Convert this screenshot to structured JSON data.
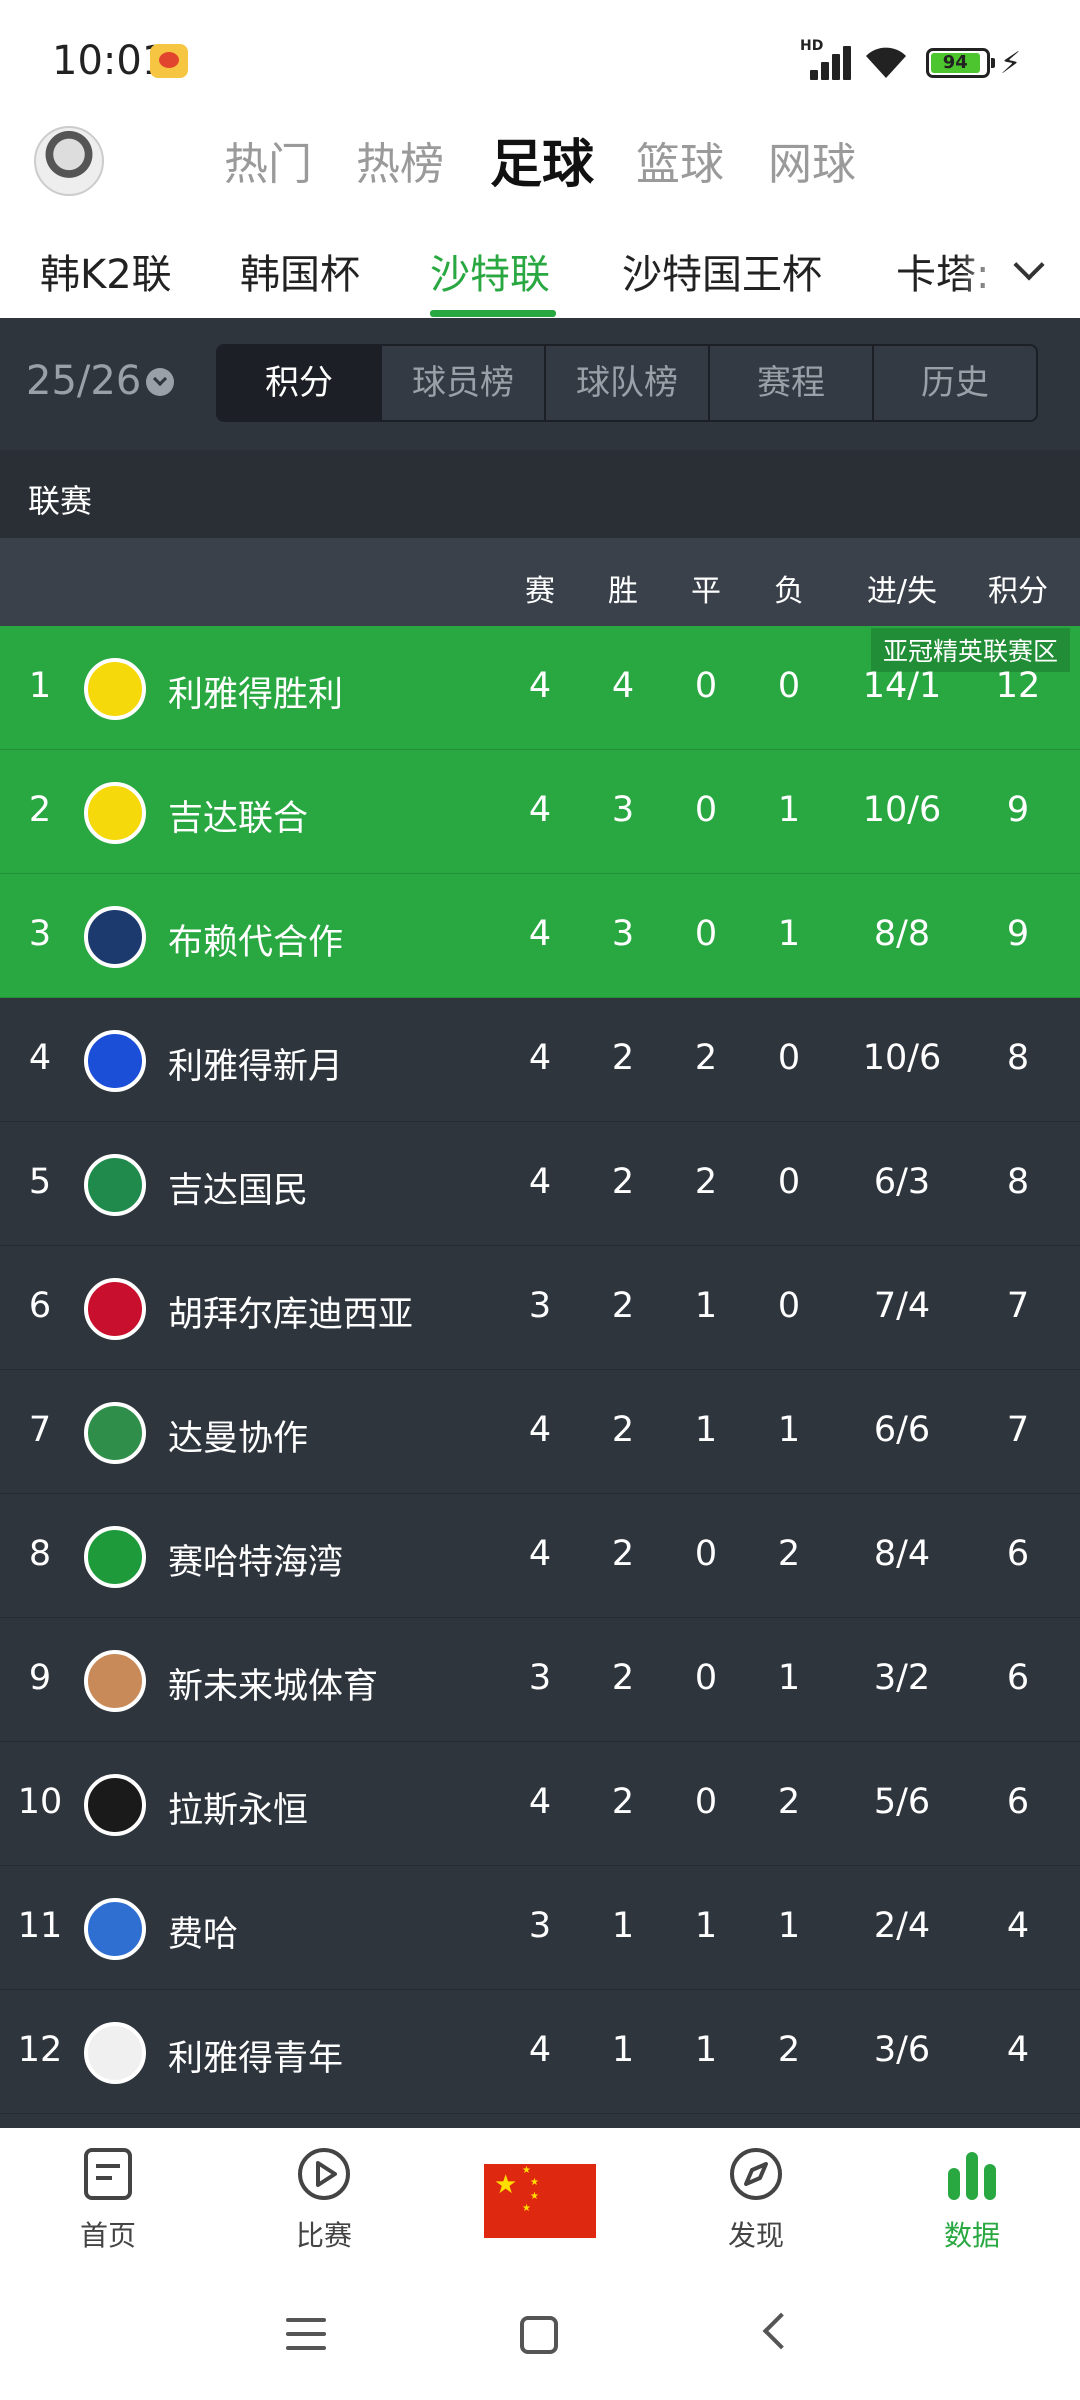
{
  "status_bar": {
    "time": "10:01",
    "network": "HD",
    "battery": "94"
  },
  "top_nav": {
    "tabs": [
      "热门",
      "热榜",
      "足球",
      "篮球",
      "网球"
    ],
    "active": "足球"
  },
  "league_tabs": {
    "items": [
      "韩K2联",
      "韩国杯",
      "沙特联",
      "沙特国王杯",
      "卡塔:"
    ],
    "active": "沙特联"
  },
  "sub_tabs": {
    "season": "25/26",
    "items": [
      "积分",
      "球员榜",
      "球队榜",
      "赛程",
      "历史"
    ],
    "active": "积分"
  },
  "section": {
    "label": "联赛"
  },
  "table": {
    "columns": {
      "played": "赛",
      "won": "胜",
      "drawn": "平",
      "lost": "负",
      "goals": "进/失",
      "points": "积分"
    },
    "zone_label": "亚冠精英联赛区",
    "rows": [
      {
        "rank": "1",
        "team": "利雅得胜利",
        "played": "4",
        "won": "4",
        "drawn": "0",
        "lost": "0",
        "goals": "14/1",
        "points": "12",
        "crest_color": "#f5d90a"
      },
      {
        "rank": "2",
        "team": "吉达联合",
        "played": "4",
        "won": "3",
        "drawn": "0",
        "lost": "1",
        "goals": "10/6",
        "points": "9",
        "crest_color": "#f5d90a"
      },
      {
        "rank": "3",
        "team": "布赖代合作",
        "played": "4",
        "won": "3",
        "drawn": "0",
        "lost": "1",
        "goals": "8/8",
        "points": "9",
        "crest_color": "#1d3a6e"
      },
      {
        "rank": "4",
        "team": "利雅得新月",
        "played": "4",
        "won": "2",
        "drawn": "2",
        "lost": "0",
        "goals": "10/6",
        "points": "8",
        "crest_color": "#1b4fd8"
      },
      {
        "rank": "5",
        "team": "吉达国民",
        "played": "4",
        "won": "2",
        "drawn": "2",
        "lost": "0",
        "goals": "6/3",
        "points": "8",
        "crest_color": "#1f8a4c"
      },
      {
        "rank": "6",
        "team": "胡拜尔库迪西亚",
        "played": "3",
        "won": "2",
        "drawn": "1",
        "lost": "0",
        "goals": "7/4",
        "points": "7",
        "crest_color": "#c8102e"
      },
      {
        "rank": "7",
        "team": "达曼协作",
        "played": "4",
        "won": "2",
        "drawn": "1",
        "lost": "1",
        "goals": "6/6",
        "points": "7",
        "crest_color": "#2f8f4a"
      },
      {
        "rank": "8",
        "team": "赛哈特海湾",
        "played": "4",
        "won": "2",
        "drawn": "0",
        "lost": "2",
        "goals": "8/4",
        "points": "6",
        "crest_color": "#1e9a3b"
      },
      {
        "rank": "9",
        "team": "新未来城体育",
        "played": "3",
        "won": "2",
        "drawn": "0",
        "lost": "1",
        "goals": "3/2",
        "points": "6",
        "crest_color": "#c98a5a"
      },
      {
        "rank": "10",
        "team": "拉斯永恒",
        "played": "4",
        "won": "2",
        "drawn": "0",
        "lost": "2",
        "goals": "5/6",
        "points": "6",
        "crest_color": "#1a1a1a"
      },
      {
        "rank": "11",
        "team": "费哈",
        "played": "3",
        "won": "1",
        "drawn": "1",
        "lost": "1",
        "goals": "2/4",
        "points": "4",
        "crest_color": "#2f6fd1"
      },
      {
        "rank": "12",
        "team": "利雅得青年",
        "played": "4",
        "won": "1",
        "drawn": "1",
        "lost": "2",
        "goals": "3/6",
        "points": "4",
        "crest_color": "#f0f0f0"
      }
    ]
  },
  "bottom_nav": {
    "items": [
      {
        "label": "首页",
        "icon": "home-doc-icon"
      },
      {
        "label": "比赛",
        "icon": "play-circle-icon"
      },
      {
        "label": "发现",
        "icon": "compass-icon"
      },
      {
        "label": "数据",
        "icon": "bar-chart-icon"
      }
    ],
    "active": "数据"
  },
  "colors": {
    "accent": "#29a842",
    "table_bg": "#2f353d",
    "header_bg": "#3a414b"
  }
}
